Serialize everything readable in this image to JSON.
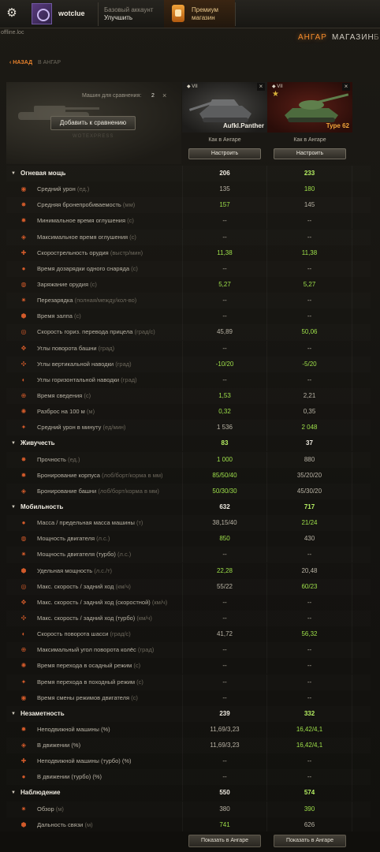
{
  "header": {
    "username": "wotclue",
    "account_type": "Базовый аккаунт",
    "upgrade": "Улучшить",
    "premium_l1": "Премиум",
    "premium_l2": "магазин",
    "server": "offline.loc",
    "nav": [
      "АНГАР",
      "МАГАЗИН",
      "Б"
    ]
  },
  "breadcrumb": {
    "back": "НАЗАД",
    "sub": "В АНГАР"
  },
  "compare": {
    "count_label": "Машин для сравнения:",
    "count": "2",
    "add_button": "Добавить к сравнению",
    "watermark": "WOTEXPRESS",
    "tanks": [
      {
        "tier": "VII",
        "name": "Aufkl.Panther",
        "config": "Как в Ангаре",
        "setup": "Настроить",
        "name_color": "#f0ece2"
      },
      {
        "tier": "VII",
        "name": "Type 62",
        "config": "Как в Ангаре",
        "setup": "Настроить",
        "name_color": "#f2a53a"
      }
    ]
  },
  "rows": [
    {
      "type": "cat",
      "label": "Огневая мощь",
      "v1": "206",
      "v2": "233",
      "g1": false,
      "g2": true
    },
    {
      "type": "stat",
      "icon": "damage-icon",
      "label": "Средний урон",
      "unit": " (ед.)",
      "v1": "135",
      "v2": "180",
      "g1": false,
      "g2": true
    },
    {
      "type": "stat",
      "icon": "penetration-icon",
      "label": "Средняя бронепробиваемость",
      "unit": " (мм)",
      "v1": "157",
      "v2": "145",
      "g1": true,
      "g2": false
    },
    {
      "type": "stat",
      "icon": "stun-min-icon",
      "label": "Минимальное время оглушения",
      "unit": " (с)",
      "v1": "--",
      "v2": "--",
      "g1": false,
      "g2": false
    },
    {
      "type": "stat",
      "icon": "stun-max-icon",
      "label": "Максимальное время оглушения",
      "unit": " (с)",
      "v1": "--",
      "v2": "--",
      "g1": false,
      "g2": false
    },
    {
      "type": "stat",
      "icon": "rate-of-fire-icon",
      "label": "Скорострельность орудия",
      "unit": " (выстр/мин)",
      "v1": "11,38",
      "v2": "11,38",
      "g1": true,
      "g2": true
    },
    {
      "type": "stat",
      "icon": "shell-reload-icon",
      "label": "Время дозарядки одного снаряда",
      "unit": " (с)",
      "v1": "--",
      "v2": "--",
      "g1": false,
      "g2": false
    },
    {
      "type": "stat",
      "icon": "reload-icon",
      "label": "Заряжание орудия",
      "unit": " (с)",
      "v1": "5,27",
      "v2": "5,27",
      "g1": true,
      "g2": true
    },
    {
      "type": "stat",
      "icon": "clip-reload-icon",
      "label": "Перезарядка",
      "unit": " (полная/между/кол-во)",
      "v1": "--",
      "v2": "--",
      "g1": false,
      "g2": false
    },
    {
      "type": "stat",
      "icon": "salvo-icon",
      "label": "Время залпа",
      "unit": " (с)",
      "v1": "--",
      "v2": "--",
      "g1": false,
      "g2": false
    },
    {
      "type": "stat",
      "icon": "aim-traverse-icon",
      "label": "Скорость гориз. перевода прицела",
      "unit": " (град/с)",
      "v1": "45,89",
      "v2": "50,06",
      "g1": false,
      "g2": true
    },
    {
      "type": "stat",
      "icon": "turret-rotation-icon",
      "label": "Углы поворота башни",
      "unit": " (град)",
      "v1": "--",
      "v2": "--",
      "g1": false,
      "g2": false
    },
    {
      "type": "stat",
      "icon": "gun-elevation-icon",
      "label": "Углы вертикальной наводки",
      "unit": " (град)",
      "v1": "-10/20",
      "v2": "-5/20",
      "g1": true,
      "g2": true
    },
    {
      "type": "stat",
      "icon": "gun-yaw-icon",
      "label": "Углы горизонтальной наводки",
      "unit": " (град)",
      "v1": "--",
      "v2": "--",
      "g1": false,
      "g2": false
    },
    {
      "type": "stat",
      "icon": "aim-time-icon",
      "label": "Время сведения",
      "unit": " (с)",
      "v1": "1,53",
      "v2": "2,21",
      "g1": true,
      "g2": false
    },
    {
      "type": "stat",
      "icon": "dispersion-icon",
      "label": "Разброс на 100 м",
      "unit": " (м)",
      "v1": "0,32",
      "v2": "0,35",
      "g1": true,
      "g2": false
    },
    {
      "type": "stat",
      "icon": "dpm-icon",
      "label": "Средний урон в минуту",
      "unit": " (ед/мин)",
      "v1": "1 536",
      "v2": "2 048",
      "g1": false,
      "g2": true
    },
    {
      "type": "cat",
      "label": "Живучесть",
      "v1": "83",
      "v2": "37",
      "g1": true,
      "g2": false
    },
    {
      "type": "stat",
      "icon": "hitpoints-icon",
      "label": "Прочность",
      "unit": " (ед.)",
      "v1": "1 000",
      "v2": "880",
      "g1": true,
      "g2": false
    },
    {
      "type": "stat",
      "icon": "hull-armor-icon",
      "label": "Бронирование корпуса",
      "unit": " (лоб/борт/корма в мм)",
      "v1": "85/50/40",
      "v2": "35/20/20",
      "g1": true,
      "g2": false
    },
    {
      "type": "stat",
      "icon": "turret-armor-icon",
      "label": "Бронирование башни",
      "unit": " (лоб/борт/корма в мм)",
      "v1": "50/30/30",
      "v2": "45/30/20",
      "g1": true,
      "g2": false
    },
    {
      "type": "cat",
      "label": "Мобильность",
      "v1": "632",
      "v2": "717",
      "g1": false,
      "g2": true
    },
    {
      "type": "stat",
      "icon": "weight-icon",
      "label": "Масса / предельная масса машины",
      "unit": " (т)",
      "v1": "38,15/40",
      "v2": "21/24",
      "g1": false,
      "g2": true
    },
    {
      "type": "stat",
      "icon": "engine-power-icon",
      "label": "Мощность двигателя",
      "unit": " (л.с.)",
      "v1": "850",
      "v2": "430",
      "g1": true,
      "g2": false
    },
    {
      "type": "stat",
      "icon": "engine-turbo-icon",
      "label": "Мощность двигателя (турбо)",
      "unit": " (л.с.)",
      "v1": "--",
      "v2": "--",
      "g1": false,
      "g2": false
    },
    {
      "type": "stat",
      "icon": "specific-power-icon",
      "label": "Удельная мощность",
      "unit": " (л.с./т)",
      "v1": "22,28",
      "v2": "20,48",
      "g1": true,
      "g2": false
    },
    {
      "type": "stat",
      "icon": "speed-limit-icon",
      "label": "Макс. скорость / задний ход",
      "unit": " (км/ч)",
      "v1": "55/22",
      "v2": "60/23",
      "g1": false,
      "g2": true
    },
    {
      "type": "stat",
      "icon": "speed-siege-icon",
      "label": "Макс. скорость / задний ход (скоростной)",
      "unit": " (км/ч)",
      "v1": "--",
      "v2": "--",
      "g1": false,
      "g2": false
    },
    {
      "type": "stat",
      "icon": "speed-turbo-icon",
      "label": "Макс. скорость / задний ход (турбо)",
      "unit": " (км/ч)",
      "v1": "--",
      "v2": "--",
      "g1": false,
      "g2": false
    },
    {
      "type": "stat",
      "icon": "chassis-rotation-icon",
      "label": "Скорость поворота шасси",
      "unit": " (град/с)",
      "v1": "41,72",
      "v2": "56,32",
      "g1": false,
      "g2": true
    },
    {
      "type": "stat",
      "icon": "wheel-angle-icon",
      "label": "Максимальный угол поворота колёс",
      "unit": " (град)",
      "v1": "--",
      "v2": "--",
      "g1": false,
      "g2": false
    },
    {
      "type": "stat",
      "icon": "siege-mode-icon",
      "label": "Время перехода в осадный режим",
      "unit": " (с)",
      "v1": "--",
      "v2": "--",
      "g1": false,
      "g2": false
    },
    {
      "type": "stat",
      "icon": "travel-mode-icon",
      "label": "Время перехода в походный режим",
      "unit": " (с)",
      "v1": "--",
      "v2": "--",
      "g1": false,
      "g2": false
    },
    {
      "type": "stat",
      "icon": "engine-mode-icon",
      "label": "Время смены режимов двигателя",
      "unit": " (с)",
      "v1": "--",
      "v2": "--",
      "g1": false,
      "g2": false
    },
    {
      "type": "cat",
      "label": "Незаметность",
      "v1": "239",
      "v2": "332",
      "g1": false,
      "g2": true
    },
    {
      "type": "stat",
      "icon": "camo-still-icon",
      "label": "Неподвижной машины (%)",
      "unit": "",
      "v1": "11,69/3,23",
      "v2": "16,42/4,1",
      "g1": false,
      "g2": true
    },
    {
      "type": "stat",
      "icon": "camo-moving-icon",
      "label": "В движении (%)",
      "unit": "",
      "v1": "11,69/3,23",
      "v2": "16,42/4,1",
      "g1": false,
      "g2": true
    },
    {
      "type": "stat",
      "icon": "camo-still-turbo-icon",
      "label": "Неподвижной машины (турбо) (%)",
      "unit": "",
      "v1": "--",
      "v2": "--",
      "g1": false,
      "g2": false
    },
    {
      "type": "stat",
      "icon": "camo-moving-turbo-icon",
      "label": "В движении (турбо) (%)",
      "unit": "",
      "v1": "--",
      "v2": "--",
      "g1": false,
      "g2": false
    },
    {
      "type": "cat",
      "label": "Наблюдение",
      "v1": "550",
      "v2": "574",
      "g1": false,
      "g2": true
    },
    {
      "type": "stat",
      "icon": "view-range-icon",
      "label": "Обзор",
      "unit": " (м)",
      "v1": "380",
      "v2": "390",
      "g1": false,
      "g2": true
    },
    {
      "type": "stat",
      "icon": "radio-range-icon",
      "label": "Дальность связи",
      "unit": " (м)",
      "v1": "741",
      "v2": "626",
      "g1": true,
      "g2": false
    }
  ],
  "footer": {
    "show1": "Показать в Ангаре",
    "show2": "Показать в Ангаре"
  },
  "colors": {
    "accent": "#f28a2c",
    "good": "#9ee04a",
    "text": "#b8b2a4"
  }
}
